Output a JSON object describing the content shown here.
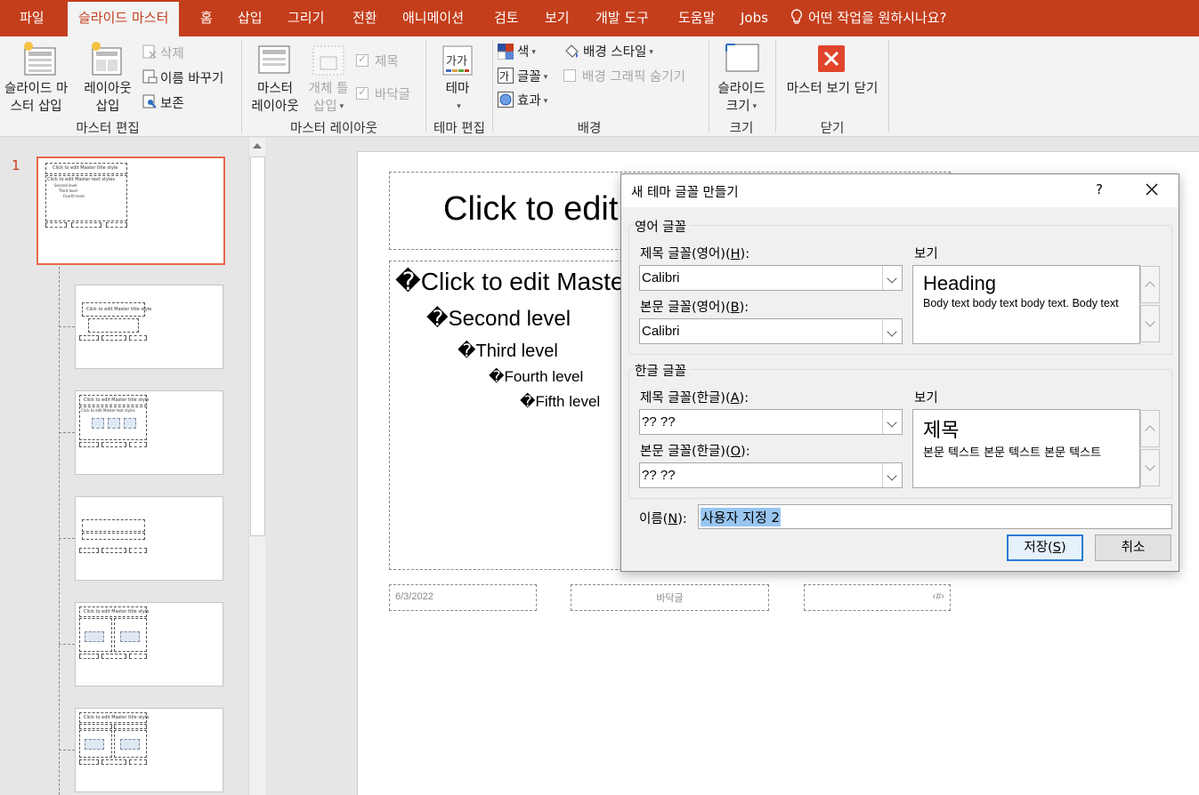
{
  "ribbon_tabs": [
    "파일",
    "슬라이드 마스터",
    "홈",
    "삽입",
    "그리기",
    "전환",
    "애니메이션",
    "검토",
    "보기",
    "개발 도구",
    "도움말",
    "Jobs"
  ],
  "tell_me": "어떤 작업을 원하시나요?",
  "ribbon": {
    "insert_slide_master": [
      "슬라이드 마",
      "스터 삽입"
    ],
    "insert_layout": [
      "레이아웃",
      "삽입"
    ],
    "delete": "삭제",
    "rename": "이름 바꾸기",
    "preserve": "보존",
    "group_edit_master": "마스터 편집",
    "master_layout": [
      "마스터",
      "레이아웃"
    ],
    "insert_placeholder": [
      "개체 틀",
      "삽입"
    ],
    "title_check": "제목",
    "footers_check": "바닥글",
    "group_master_layout": "마스터 레이아웃",
    "themes": "테마",
    "group_edit_theme": "테마 편집",
    "colors": "색",
    "fonts": "글꼴",
    "effects": "효과",
    "background_styles": "배경 스타일",
    "hide_background_graphics": "배경 그래픽 숨기기",
    "group_background": "배경",
    "slide_size": [
      "슬라이드",
      "크기"
    ],
    "group_size": "크기",
    "close_master_view": "마스터 보기 닫기",
    "group_close": "닫기"
  },
  "thumbnails": {
    "slide_number": "1",
    "master_title": "Click to edit Master title style",
    "master_text": "Click to edit Master text styles",
    "levels": [
      "Second level",
      "Third level",
      "Fourth level"
    ]
  },
  "slide": {
    "title": "Click to edit",
    "bullet": "�",
    "levels": [
      "Click to edit Maste",
      "Second level",
      "Third level",
      "Fourth level",
      "Fifth level"
    ],
    "date": "6/3/2022",
    "footer": "바닥글",
    "number": "‹#›"
  },
  "dialog": {
    "title": "새 테마 글꼴 만들기",
    "help": "?",
    "latin_group": "영어 글꼴",
    "heading_label": "제목 글꼴(영어)(",
    "heading_key": "H",
    "body_label": "본문 글꼴(영어)(",
    "body_key": "B",
    "heading_font": "Calibri",
    "body_font": "Calibri",
    "sample_label": "보기",
    "sample_heading": "Heading",
    "sample_body": "Body text body text body text. Body text",
    "asian_group": "한글 글꼴",
    "asian_heading_label": "제목 글꼴(한글)(",
    "asian_heading_key": "A",
    "asian_body_label": "본문 글꼴(한글)(",
    "asian_body_key": "O",
    "asian_heading_font": "?? ??",
    "asian_body_font": "?? ??",
    "asian_sample_label": "보기",
    "asian_sample_heading": "제목",
    "asian_sample_body": "본문 텍스트 본문 텍스트 본문 텍스트",
    "name_label": "이름(",
    "name_key": "N",
    "name_suffix": "):",
    "name_value": "사용자 지정 2",
    "save": "저장(",
    "save_key": "S",
    "cancel": "취소",
    "close_paren": "):",
    "close_paren_btn": ")"
  },
  "colors": {
    "accent": "#c43e1c",
    "selection": "#e8694a",
    "default_button": "#2b7cd3"
  }
}
